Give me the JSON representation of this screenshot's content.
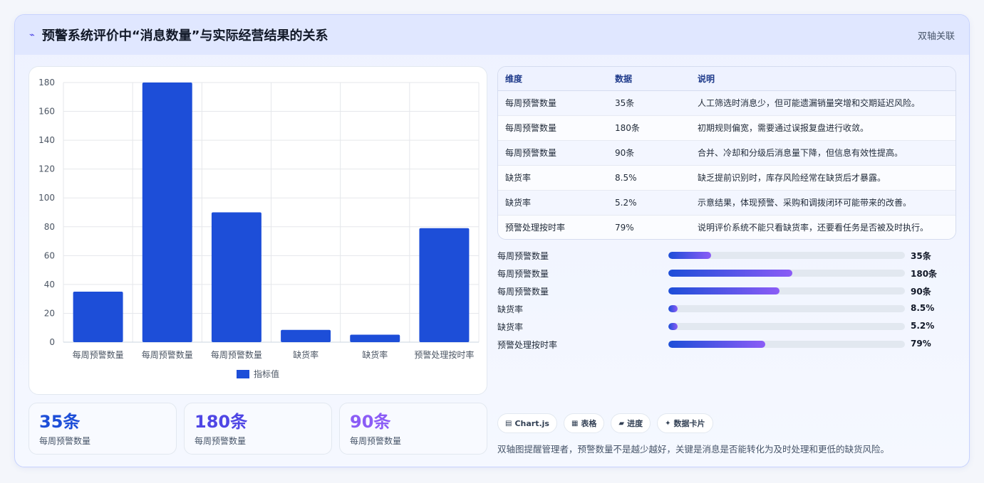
{
  "header": {
    "title": "预警系统评价中“消息数量”与实际经营结果的关系",
    "tag": "双轴关联"
  },
  "chart_data": {
    "type": "bar",
    "categories": [
      "每周预警数量",
      "每周预警数量",
      "每周预警数量",
      "缺货率",
      "缺货率",
      "预警处理按时率"
    ],
    "series": [
      {
        "name": "指标值",
        "values": [
          35,
          180,
          90,
          8.5,
          5.2,
          79
        ]
      }
    ],
    "ylim": [
      0,
      180
    ],
    "yticks": [
      0,
      20,
      40,
      60,
      80,
      100,
      120,
      140,
      160,
      180
    ],
    "legend_position": "bottom",
    "grid": true,
    "color": "#1d4ed8"
  },
  "stats": [
    {
      "value": "35条",
      "label": "每周预警数量",
      "color": "#1d4ed8"
    },
    {
      "value": "180条",
      "label": "每周预警数量",
      "color": "#4f46e5"
    },
    {
      "value": "90条",
      "label": "每周预警数量",
      "color": "#8b5cf6"
    }
  ],
  "table": {
    "headers": [
      "维度",
      "数据",
      "说明"
    ],
    "rows": [
      [
        "每周预警数量",
        "35条",
        "人工筛选时消息少，但可能遗漏销量突增和交期延迟风险。"
      ],
      [
        "每周预警数量",
        "180条",
        "初期规则偏宽，需要通过误报复盘进行收敛。"
      ],
      [
        "每周预警数量",
        "90条",
        "合并、冷却和分级后消息量下降，但信息有效性提高。"
      ],
      [
        "缺货率",
        "8.5%",
        "缺乏提前识别时，库存风险经常在缺货后才暴露。"
      ],
      [
        "缺货率",
        "5.2%",
        "示意结果，体现预警、采购和调拨闭环可能带来的改善。"
      ],
      [
        "预警处理按时率",
        "79%",
        "说明评价系统不能只看缺货率，还要看任务是否被及时执行。"
      ]
    ]
  },
  "progress": [
    {
      "label": "每周预警数量",
      "value": "35条",
      "fraction": 0.18
    },
    {
      "label": "每周预警数量",
      "value": "180条",
      "fraction": 0.525
    },
    {
      "label": "每周预警数量",
      "value": "90条",
      "fraction": 0.47
    },
    {
      "label": "缺货率",
      "value": "8.5%",
      "fraction": 0.04
    },
    {
      "label": "缺货率",
      "value": "5.2%",
      "fraction": 0.04
    },
    {
      "label": "预警处理按时率",
      "value": "79%",
      "fraction": 0.41
    }
  ],
  "chips": [
    {
      "icon": "▤",
      "icon_name": "chart-icon",
      "label": "Chart.js"
    },
    {
      "icon": "▦",
      "icon_name": "table-icon",
      "label": "表格"
    },
    {
      "icon": "▰",
      "icon_name": "progress-icon",
      "label": "进度"
    },
    {
      "icon": "✦",
      "icon_name": "sparkle-icon",
      "label": "数据卡片"
    }
  ],
  "note": "双轴图提醒管理者，预警数量不是越少越好，关键是消息是否能转化为及时处理和更低的缺货风险。"
}
